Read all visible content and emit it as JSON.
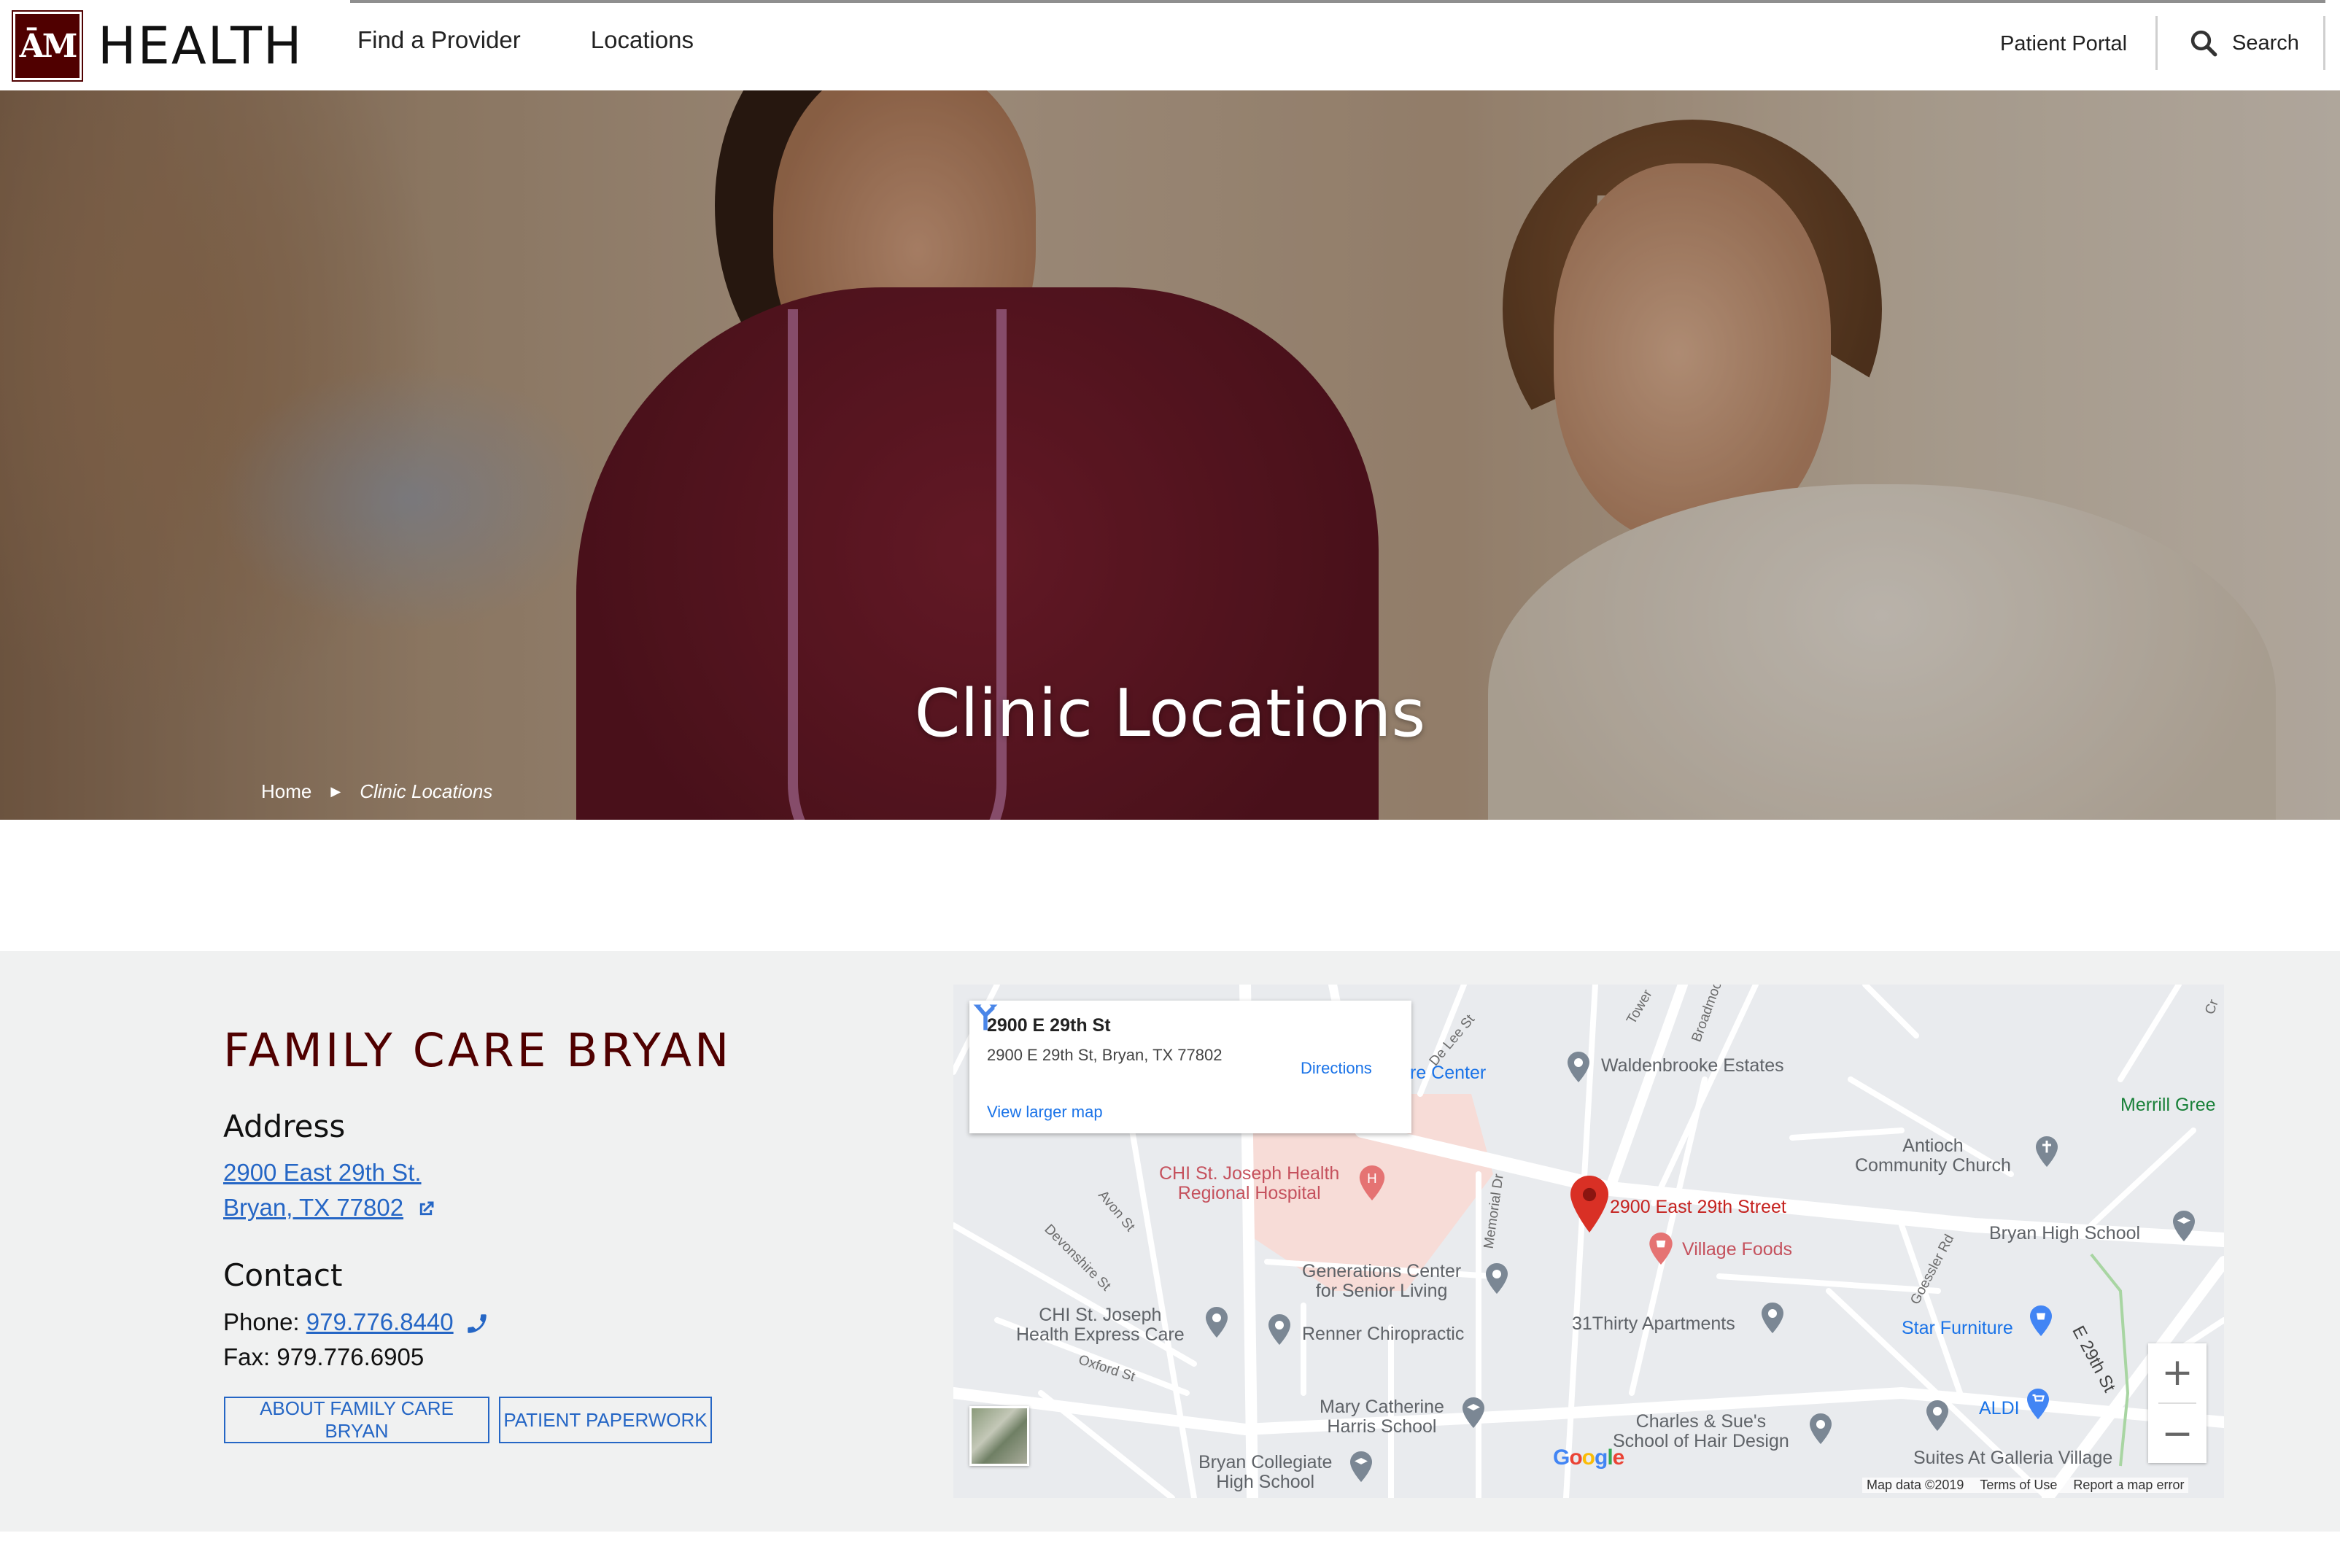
{
  "header": {
    "logo_mark": "ĀM",
    "logo_text": "HEALTH",
    "nav": [
      "Find a Provider",
      "Locations"
    ],
    "patient_portal": "Patient Portal",
    "search_label": "Search"
  },
  "hero": {
    "title": "Clinic Locations",
    "breadcrumb": [
      "Home",
      "Clinic Locations"
    ]
  },
  "clinic": {
    "name": "FAMILY CARE BRYAN",
    "address_heading": "Address",
    "address_line1": "2900 East 29th St.",
    "address_line2": "Bryan, TX 77802",
    "contact_heading": "Contact",
    "phone_label": "Phone:",
    "phone": "979.776.8440",
    "fax": "Fax: 979.776.6905",
    "buttons": [
      "ABOUT FAMILY CARE BRYAN",
      "PATIENT PAPERWORK"
    ]
  },
  "map": {
    "info_title": "2900 E 29th St",
    "info_address": "2900 E 29th St, Bryan, TX 77802",
    "directions": "Directions",
    "view_larger": "View larger map",
    "pin_label": "2900 East 29th Street",
    "places": {
      "center_partial": "re Center",
      "walden": "Waldenbrooke Estates",
      "merrill": "Merrill Gree",
      "antioch": "Antioch\nCommunity Church",
      "chi_hospital": "CHI St. Joseph Health\nRegional Hospital",
      "village_foods": "Village Foods",
      "bryan_high": "Bryan High School",
      "generations": "Generations Center\nfor Senior Living",
      "chi_express": "CHI St. Joseph\nHealth Express Care",
      "renner": "Renner Chiropractic",
      "thirty_one": "31Thirty Apartments",
      "star_furniture": "Star Furniture",
      "aldi": "ALDI",
      "mary_catherine": "Mary Catherine\nHarris School",
      "charles_sues": "Charles & Sue's\nSchool of Hair Design",
      "bryan_collegiate": "Bryan Collegiate\nHigh School",
      "galleria": "Suites At Galleria Village"
    },
    "streets": [
      "De Lee St",
      "Tower",
      "Broadmoo",
      "Avon St",
      "Devonshire St",
      "Oxford St",
      "Memorial Dr",
      "Goessler Rd",
      "E 29th St",
      "Cr"
    ],
    "zoom_in": "+",
    "zoom_out": "−",
    "google": "Google",
    "attribution": [
      "Map data ©2019",
      "Terms of Use",
      "Report a map error"
    ]
  }
}
